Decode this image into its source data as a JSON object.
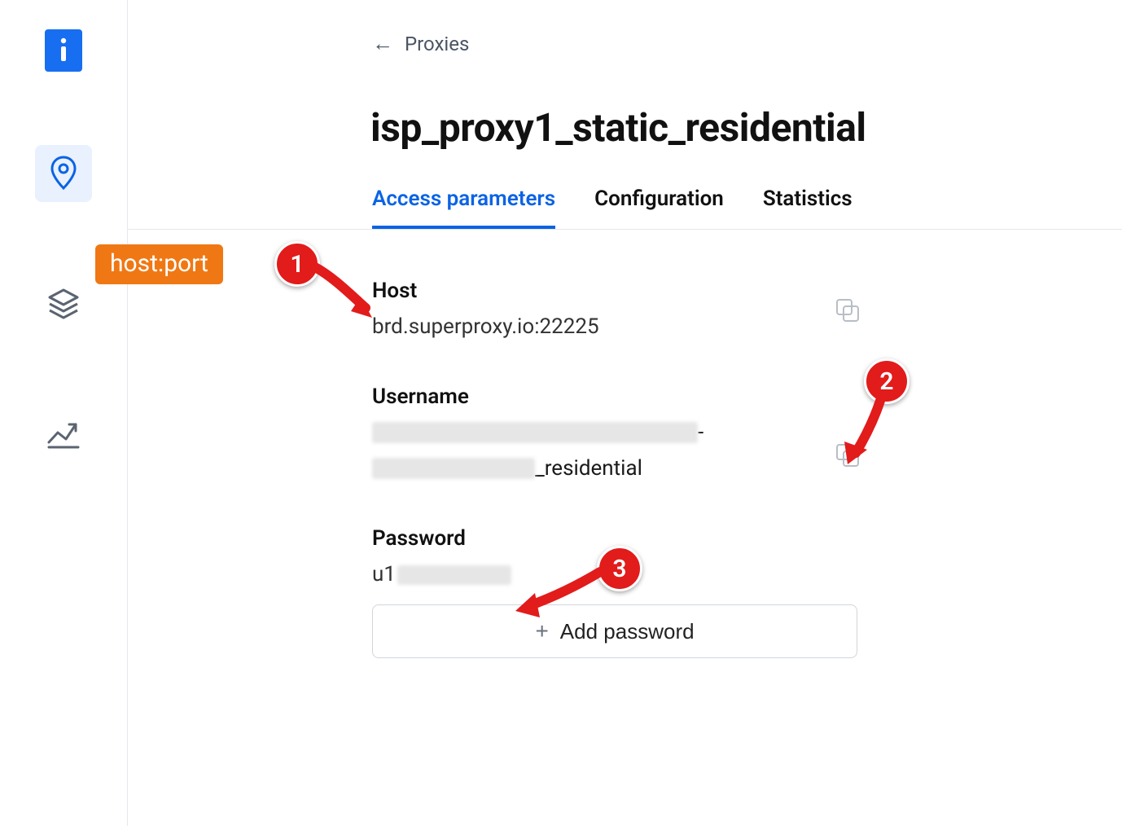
{
  "breadcrumb": {
    "back_label": "Proxies"
  },
  "page": {
    "title": "isp_proxy1_static_residential"
  },
  "tabs": [
    {
      "label": "Access parameters",
      "active": true
    },
    {
      "label": "Configuration",
      "active": false
    },
    {
      "label": "Statistics",
      "active": false
    }
  ],
  "fields": {
    "host": {
      "label": "Host",
      "value": "brd.superproxy.io:22225"
    },
    "username": {
      "label": "Username",
      "visible_suffix_row1": "-",
      "visible_suffix_row2": "_residential"
    },
    "password": {
      "label": "Password",
      "visible_prefix": "u1",
      "add_button": "Add password"
    }
  },
  "annotations": {
    "tag1": "host:port",
    "badge1": "1",
    "badge2": "2",
    "badge3": "3"
  }
}
